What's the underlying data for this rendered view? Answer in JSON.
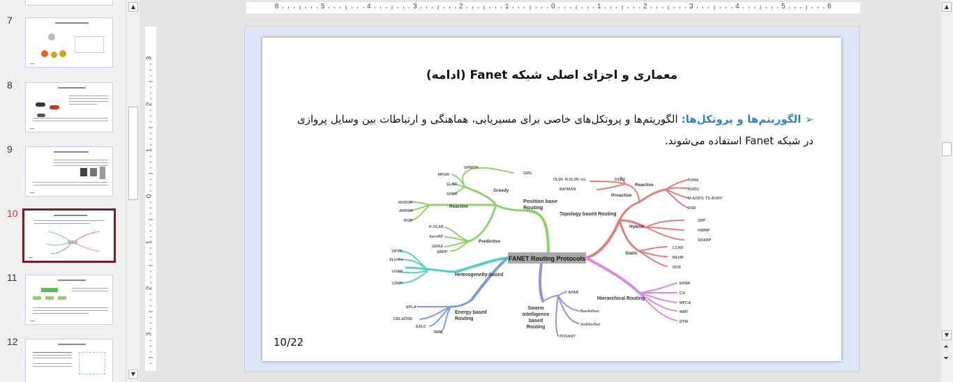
{
  "thumbnails": [
    {
      "number": "7"
    },
    {
      "number": "8"
    },
    {
      "number": "9"
    },
    {
      "number": "10",
      "active": true
    },
    {
      "number": "11"
    },
    {
      "number": "12"
    }
  ],
  "ruler": {
    "horizontal": [
      "6",
      "5",
      "4",
      "3",
      "2",
      "1",
      "0",
      "1",
      "2",
      "3",
      "4",
      "5",
      "6"
    ],
    "vertical": [
      "3",
      "2",
      "1",
      "0",
      "1",
      "2",
      "3"
    ]
  },
  "slide": {
    "title": "معماری و اجزای اصلی شبکه Fanet (ادامه)",
    "bullet_lead": "الگوریتم‌ها و پروتکل‌ها:",
    "bullet_text": " الگوریتم‌ها و پروتکل‌های خاصی برای مسیریابی، هماهنگی و ارتباطات بین وسایل پروازی در شبکه Fanet استفاده می‌شوند.",
    "page_number": "10/22"
  },
  "mindmap": {
    "root": "FANET Routing Protocols",
    "position_base": "Position base Routing",
    "greedy": "Greedy",
    "greedy_items": [
      "GPMOR",
      "GRG",
      "MPGR",
      "GLSR",
      "GPSR"
    ],
    "reactive_left": "Reactive",
    "reactive_left_items": [
      "MUDOR",
      "ARPAM",
      "RGR"
    ],
    "predictive": "Predictive",
    "predictive_items": [
      "P-OLSR",
      "AeroRP",
      "GRAA",
      "ABPP"
    ],
    "heterogeneity": "Heterogeneity-based",
    "heterogeneity_items": [
      "DPTR",
      "XLinGo",
      "UVAR",
      "CRUV"
    ],
    "energy": "Energy based Routing",
    "energy_items": [
      "EPLA",
      "CBLADSR",
      "EALC",
      "IMRL"
    ],
    "swarm": "Swarm Intelligence based Routing",
    "swarm_items": [
      "APAR",
      "BeeAdhoc",
      "AntHocNet",
      "POSANT"
    ],
    "topology": "Topology based Routing",
    "proactive": "Proactive",
    "proactive_items": [
      "OLSR, M-OLSR, etc.",
      "DSDV",
      "BATMAN"
    ],
    "reactive_right": "Reactive",
    "reactive_right_items": [
      "TORA",
      "AODV,",
      "M-AODV, TS-AODV",
      "DSR"
    ],
    "hybrid": "Hybrid",
    "hybrid_items": [
      "ZRP",
      "HWMP",
      "SHARP"
    ],
    "static": "Static",
    "static_items": [
      "LCAD",
      "MLHR",
      "DCR"
    ],
    "hierarchical": "Hierarchical Routing",
    "hierarchical_items": [
      "EHSR",
      "CA",
      "MPCA",
      "MMT",
      "DTM"
    ],
    "colors": {
      "position": "#8fd16b",
      "hetero": "#56d1bf",
      "energy": "#7b9be0",
      "swarm": "#9b8fe0",
      "topology": "#e07e7e",
      "hierarchical": "#d98be0"
    }
  }
}
